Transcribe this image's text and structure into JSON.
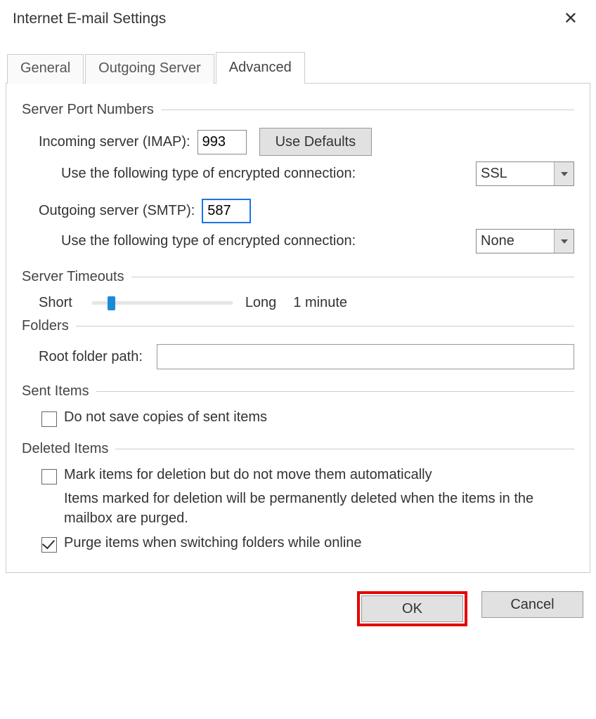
{
  "dialog": {
    "title": "Internet E-mail Settings"
  },
  "tabs": {
    "general": "General",
    "outgoing": "Outgoing Server",
    "advanced": "Advanced"
  },
  "groups": {
    "ports": "Server Port Numbers",
    "timeouts": "Server Timeouts",
    "folders": "Folders",
    "sent": "Sent Items",
    "deleted": "Deleted Items"
  },
  "ports": {
    "incoming_label": "Incoming server (IMAP):",
    "incoming_value": "993",
    "defaults_btn": "Use Defaults",
    "enc_label": "Use the following type of encrypted connection:",
    "incoming_enc": "SSL",
    "outgoing_label": "Outgoing server (SMTP):",
    "outgoing_value": "587",
    "outgoing_enc": "None"
  },
  "timeouts": {
    "short": "Short",
    "long": "Long",
    "value": "1 minute"
  },
  "folders": {
    "root_label": "Root folder path:",
    "root_value": ""
  },
  "sent": {
    "no_save_label": "Do not save copies of sent items",
    "no_save_checked": false
  },
  "deleted": {
    "mark_label": "Mark items for deletion but do not move them automatically",
    "mark_checked": false,
    "mark_help": "Items marked for deletion will be permanently deleted when the items in the mailbox are purged.",
    "purge_label": "Purge items when switching folders while online",
    "purge_checked": true
  },
  "buttons": {
    "ok": "OK",
    "cancel": "Cancel"
  }
}
